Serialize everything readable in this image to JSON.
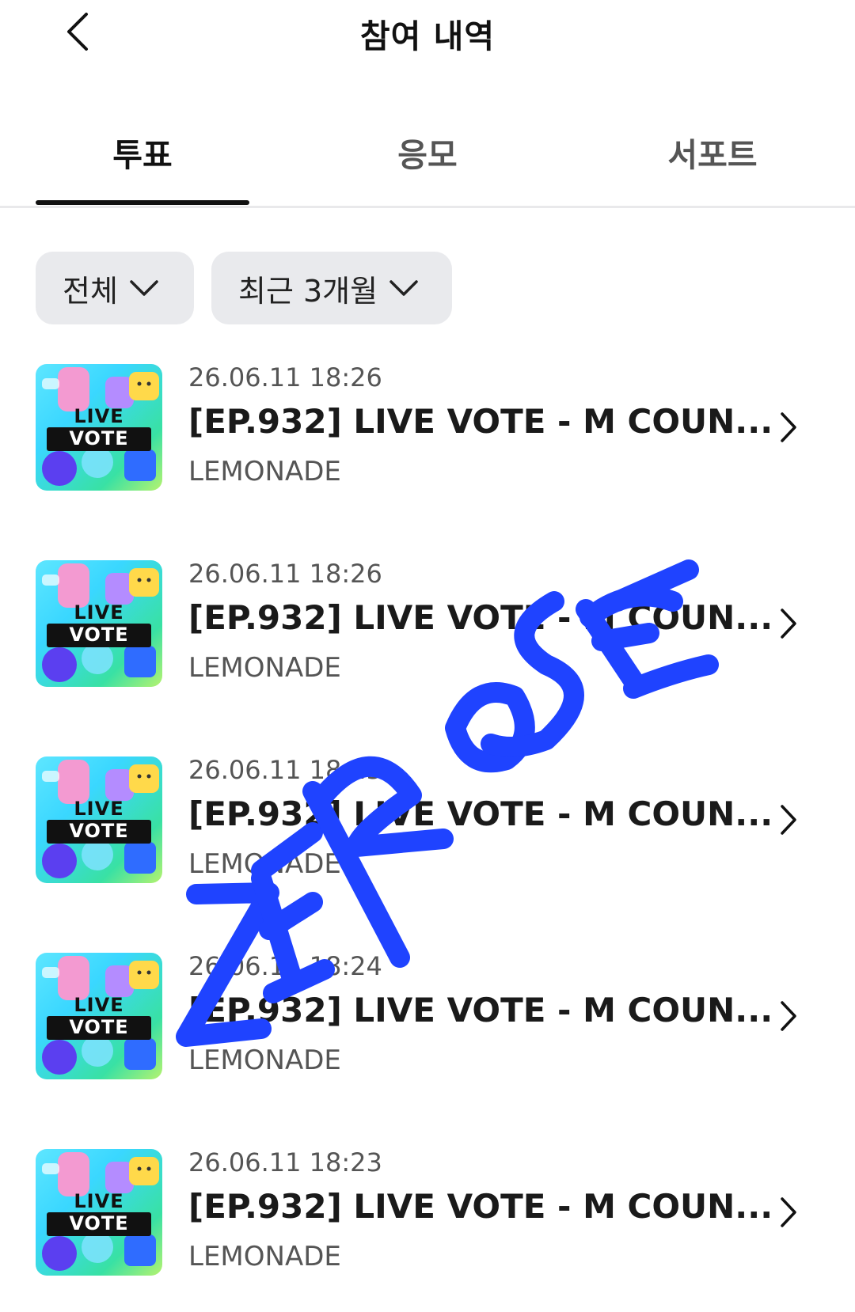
{
  "header": {
    "title": "참여 내역",
    "back_icon": "chevron-left-icon"
  },
  "tabs": [
    {
      "label": "투표",
      "active": true
    },
    {
      "label": "응모",
      "active": false
    },
    {
      "label": "서포트",
      "active": false
    }
  ],
  "filters": [
    {
      "label": "전체",
      "icon": "chevron-down-icon"
    },
    {
      "label": "최근 3개월",
      "icon": "chevron-down-icon"
    }
  ],
  "thumbnail": {
    "line1": "LIVE",
    "line2": "VOTE"
  },
  "votes": [
    {
      "date": "26.06.11 18:26",
      "title": "[EP.932] LIVE VOTE - M COUN...",
      "artist": "LEMONADE"
    },
    {
      "date": "26.06.11 18:26",
      "title": "[EP.932] LIVE VOTE - M COUN...",
      "artist": "LEMONADE"
    },
    {
      "date": "26.06.11 18:25",
      "title": "[EP.932] LIVE VOTE - M COUN...",
      "artist": "LEMONADE"
    },
    {
      "date": "26.06.11 18:24",
      "title": "[EP.932] LIVE VOTE - M COUN...",
      "artist": "LEMONADE"
    },
    {
      "date": "26.06.11 18:23",
      "title": "[EP.932] LIVE VOTE - M COUN...",
      "artist": "LEMONADE"
    }
  ],
  "watermark_text": "ZEROSE",
  "colors": {
    "watermark": "#1f43ff",
    "text": "#111111",
    "chip": "#e9eaed",
    "subtle": "#555555"
  }
}
